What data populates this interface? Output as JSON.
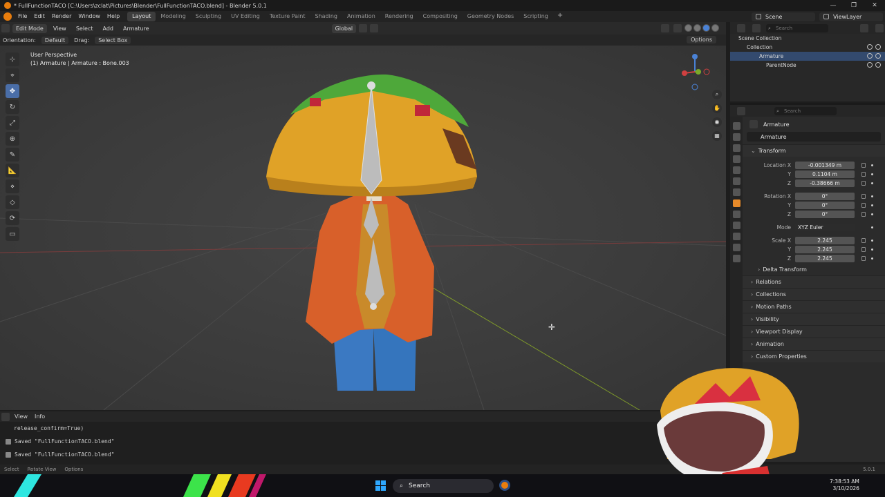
{
  "titlebar": {
    "title": "* FullFunctionTACO [C:\\Users\\zclat\\Pictures\\Blender\\FullFunctionTACO.blend] - Blender 5.0.1",
    "controls": [
      "—",
      "❐",
      "✕"
    ]
  },
  "menu": {
    "items": [
      "File",
      "Edit",
      "Render",
      "Window",
      "Help"
    ],
    "workspaces": [
      "Layout",
      "Modeling",
      "Sculpting",
      "UV Editing",
      "Texture Paint",
      "Shading",
      "Animation",
      "Rendering",
      "Compositing",
      "Geometry Nodes",
      "Scripting"
    ],
    "active_workspace": "Layout",
    "add": "+",
    "scene": "Scene",
    "view_layer": "ViewLayer"
  },
  "viewport_header": {
    "mode": "Edit Mode",
    "menus": [
      "View",
      "Select",
      "Add",
      "Armature"
    ],
    "transform_orientation": "Global"
  },
  "tool_settings": {
    "orientation_label": "Orientation:",
    "orientation_value": "Default",
    "drag_label": "Drag:",
    "drag_value": "Select Box",
    "options": "Options"
  },
  "viewport": {
    "perspective": "User Perspective",
    "context": "(1) Armature | Armature : Bone.003",
    "tools": [
      "cursor",
      "select",
      "move",
      "rotate",
      "scale",
      "transform",
      "annotate",
      "measure",
      "bone-size",
      "bone-envelope",
      "roll",
      "extrude"
    ]
  },
  "outliner": {
    "search_placeholder": "Search",
    "rows": [
      {
        "label": "Scene Collection",
        "indent": 0
      },
      {
        "label": "Collection",
        "indent": 1
      },
      {
        "label": "Armature",
        "indent": 2,
        "selected": true
      },
      {
        "label": "ParentNode",
        "indent": 2
      }
    ]
  },
  "properties": {
    "search_placeholder": "Search",
    "object_name": "Armature",
    "object_field": "Armature",
    "transform_title": "Transform",
    "location": {
      "label_x": "Location X",
      "x": "-0.001349 m",
      "y": "0.1104 m",
      "z": "-0.38666 m"
    },
    "rotation": {
      "label_x": "Rotation X",
      "x": "0°",
      "y": "0°",
      "z": "0°"
    },
    "mode": {
      "label": "Mode",
      "value": "XYZ Euler"
    },
    "scale": {
      "label_x": "Scale X",
      "x": "2.245",
      "y": "2.245",
      "z": "2.245"
    },
    "axis_y": "Y",
    "axis_z": "Z",
    "delta_transform": "Delta Transform",
    "panels": [
      "Relations",
      "Collections",
      "Motion Paths",
      "Visibility",
      "Viewport Display",
      "Animation",
      "Custom Properties"
    ]
  },
  "info": {
    "menus": [
      "View",
      "Info"
    ],
    "lines": [
      "release_confirm=True)",
      "Saved \"FullFunctionTACO.blend\"",
      "Saved \"FullFunctionTACO.blend\""
    ]
  },
  "statusbar": {
    "items": [
      "Select",
      "Rotate View",
      "Options"
    ],
    "version": "5.0.1"
  },
  "taskbar": {
    "search": "Search",
    "time": "7:38:53 AM",
    "date": "3/10/2026"
  },
  "colors": {
    "accent": "#4a82d6",
    "selection": "#334a6e",
    "blender_orange": "#e87d0d"
  }
}
